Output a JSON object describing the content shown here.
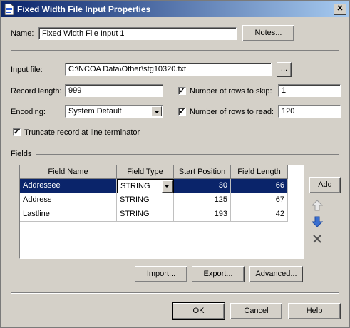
{
  "window": {
    "title": "Fixed Width File Input Properties",
    "close_glyph": "✕"
  },
  "name": {
    "label": "Name:",
    "value": "Fixed Width File Input 1",
    "notes_button": "Notes..."
  },
  "input_file": {
    "label": "Input file:",
    "value": "C:\\NCOA Data\\Other\\stg10320.txt",
    "browse_button": "..."
  },
  "record_length": {
    "label": "Record length:",
    "value": "999"
  },
  "encoding": {
    "label": "Encoding:",
    "value": "System Default"
  },
  "rows_to_skip": {
    "label": "Number of rows to skip:",
    "value": "1",
    "checked": true
  },
  "rows_to_read": {
    "label": "Number of rows to read:",
    "value": "120",
    "checked": true
  },
  "truncate": {
    "label": "Truncate record at line terminator",
    "checked": true
  },
  "fields": {
    "section_label": "Fields",
    "columns": [
      "Field Name",
      "Field Type",
      "Start Position",
      "Field Length"
    ],
    "rows": [
      {
        "name": "Addressee",
        "type": "STRING",
        "start": "30",
        "length": "66",
        "selected": true
      },
      {
        "name": "Address",
        "type": "STRING",
        "start": "125",
        "length": "67"
      },
      {
        "name": "Lastline",
        "type": "STRING",
        "start": "193",
        "length": "42"
      }
    ],
    "add_button": "Add",
    "import_button": "Import...",
    "export_button": "Export...",
    "advanced_button": "Advanced..."
  },
  "footer": {
    "ok": "OK",
    "cancel": "Cancel",
    "help": "Help"
  },
  "colors": {
    "selection": "#0a246a",
    "title_gradient_start": "#0a246a",
    "arrow_blue": "#3a6fd0",
    "face": "#d4d0c8"
  },
  "icons": [
    "document-icon",
    "close-icon",
    "move-up-arrow-icon",
    "move-down-arrow-icon",
    "delete-x-icon",
    "dropdown-arrow-icon"
  ]
}
